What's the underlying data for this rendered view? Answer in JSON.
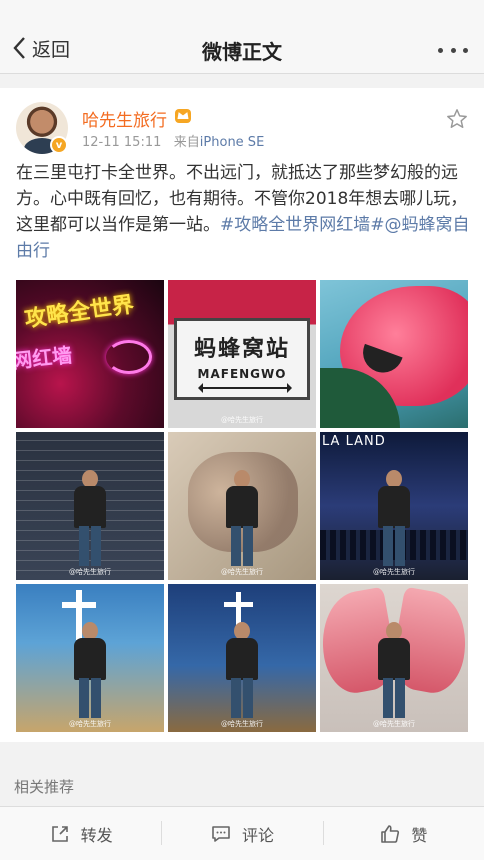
{
  "navbar": {
    "back_label": "返回",
    "title": "微博正文"
  },
  "post": {
    "username": "哈先生旅行",
    "time": "12-11 15:11",
    "source_prefix": "来自",
    "source": "iPhone SE",
    "text": "在三里屯打卡全世界。不出远门，就抵达了那些梦幻般的远方。心中既有回忆，也有期待。不管你2018年想去哪儿玩，这里都可以当作是第一站。",
    "topic": "#攻略全世界网红墙#",
    "mention": "@蚂蜂窝自由行",
    "verified_badge": "v",
    "photos": [
      {
        "text_lines": [
          "攻略全世界",
          "网红墙"
        ]
      },
      {
        "text_lines": [
          "蚂蜂窝站",
          "MAFENGWO"
        ],
        "watermark": "@哈先生旅行"
      },
      {
        "text_lines": []
      },
      {
        "text_lines": [],
        "watermark": "@哈先生旅行"
      },
      {
        "text_lines": [],
        "watermark": "@哈先生旅行"
      },
      {
        "text_lines": [
          "LA LAND"
        ],
        "watermark": "@哈先生旅行"
      },
      {
        "text_lines": [],
        "watermark": "@哈先生旅行"
      },
      {
        "text_lines": [],
        "watermark": "@哈先生旅行"
      },
      {
        "text_lines": [],
        "watermark": "@哈先生旅行"
      }
    ]
  },
  "related": {
    "label": "相关推荐"
  },
  "toolbar": {
    "repost_label": "转发",
    "comment_label": "评论",
    "like_label": "赞"
  },
  "colors": {
    "username": "#f36c21",
    "link": "#5d7ba8",
    "badge": "#f5a623"
  }
}
